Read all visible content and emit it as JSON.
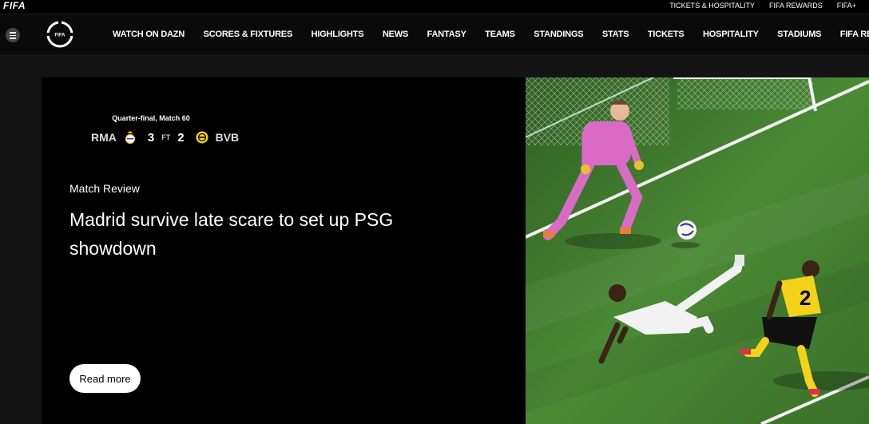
{
  "utility": {
    "logo": "FIFA",
    "links": [
      "TICKETS & HOSPITALITY",
      "FIFA REWARDS",
      "FIFA+"
    ]
  },
  "nav": {
    "crest_text": "FIFA",
    "items": [
      "WATCH ON DAZN",
      "SCORES & FIXTURES",
      "HIGHLIGHTS",
      "NEWS",
      "FANTASY",
      "TEAMS",
      "STANDINGS",
      "STATS",
      "TICKETS",
      "HOSPITALITY",
      "STADIUMS",
      "FIFA REWARDS"
    ]
  },
  "match": {
    "stage": "Quarter-final, Match 60",
    "home": "RMA",
    "home_score": "3",
    "status": "FT",
    "away_score": "2",
    "away": "BVB"
  },
  "article": {
    "eyebrow": "Match Review",
    "headline": "Madrid survive late scare to set up PSG showdown",
    "cta": "Read more"
  },
  "colors": {
    "pitch": "#3f7a2e",
    "keeper_kit": "#d96bc7",
    "bvb_yellow": "#f4d21a"
  },
  "photo": {
    "player_number": "2"
  }
}
